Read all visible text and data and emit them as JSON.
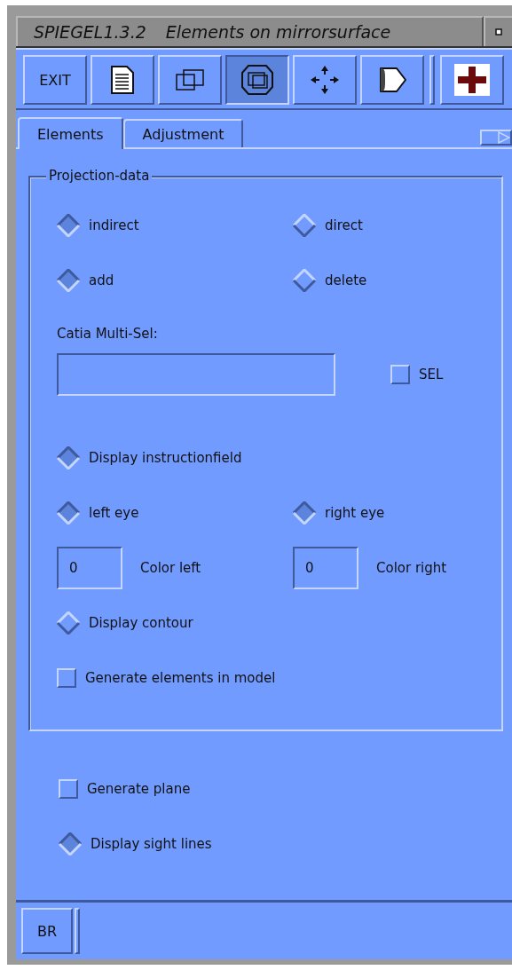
{
  "window": {
    "app": "SPIEGEL1.3.2",
    "title": "Elements on mirrorsurface"
  },
  "toolbar": [
    {
      "kind": "text",
      "label": "EXIT",
      "selected": false
    },
    {
      "kind": "document",
      "selected": false
    },
    {
      "kind": "frames",
      "selected": false
    },
    {
      "kind": "nested-frames",
      "selected": true
    },
    {
      "kind": "move",
      "selected": false
    },
    {
      "kind": "shape",
      "selected": false
    },
    {
      "kind": "separator"
    },
    {
      "kind": "cross",
      "selected": false
    }
  ],
  "tabs": [
    {
      "label": "Elements",
      "selected": true
    },
    {
      "label": "Adjustment",
      "selected": false
    }
  ],
  "group": {
    "title": "Projection-data",
    "rows": [
      {
        "kind": "pair",
        "items": [
          {
            "kind": "radio",
            "label": "indirect",
            "on": true
          },
          {
            "kind": "radio",
            "label": "direct",
            "on": false
          }
        ]
      },
      {
        "kind": "pair",
        "items": [
          {
            "kind": "radio",
            "label": "add",
            "on": true
          },
          {
            "kind": "radio",
            "label": "delete",
            "on": false
          }
        ]
      },
      {
        "kind": "caption",
        "items": [
          {
            "kind": "label",
            "label": "Catia Multi-Sel:"
          }
        ]
      },
      {
        "kind": "entry",
        "items": [
          {
            "kind": "wide-field",
            "value": ""
          },
          {
            "kind": "checkbox",
            "label": "SEL",
            "on": false
          }
        ]
      },
      {
        "kind": "single",
        "items": [
          {
            "kind": "radio",
            "label": "Display instructionfield",
            "on": true
          }
        ]
      },
      {
        "kind": "pair",
        "items": [
          {
            "kind": "radio",
            "label": "left eye",
            "on": true
          },
          {
            "kind": "radio",
            "label": "right eye",
            "on": true
          }
        ]
      },
      {
        "kind": "fields",
        "items": [
          {
            "kind": "field",
            "value": "0"
          },
          {
            "kind": "label",
            "label": "Color left"
          },
          {
            "kind": "field",
            "value": "0"
          },
          {
            "kind": "label",
            "label": "Color right"
          }
        ]
      },
      {
        "kind": "single",
        "items": [
          {
            "kind": "radio",
            "label": "Display contour",
            "on": false
          }
        ]
      },
      {
        "kind": "single",
        "items": [
          {
            "kind": "checkbox",
            "label": "Generate elements in model",
            "on": false
          }
        ]
      }
    ]
  },
  "options": [
    {
      "kind": "checkbox",
      "label": "Generate plane",
      "on": false
    },
    {
      "kind": "radio",
      "label": "Display sight lines",
      "on": true
    }
  ],
  "footer": {
    "buttons": [
      "BR"
    ]
  }
}
